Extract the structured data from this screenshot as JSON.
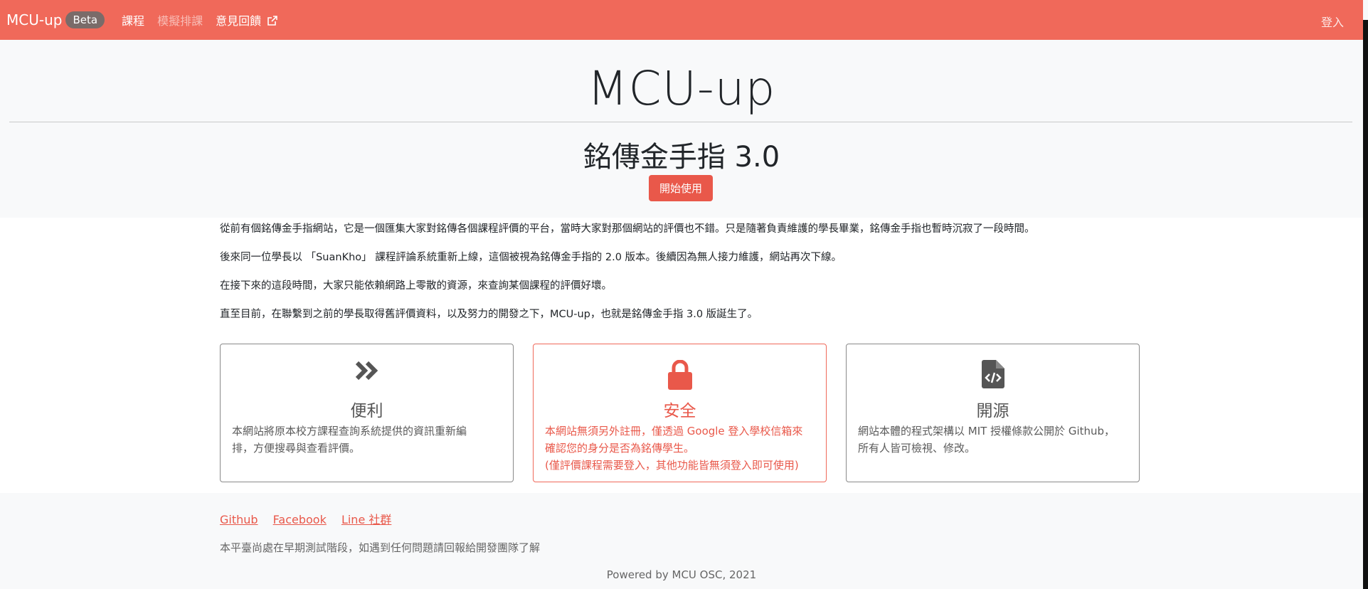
{
  "navbar": {
    "brand": "MCU-up",
    "badge": "Beta",
    "links": [
      "課程",
      "模擬排課",
      "意見回饋"
    ],
    "login": "登入",
    "colors": {
      "brand_bg": "#f0695a",
      "badge_bg": "#7a6b69"
    }
  },
  "hero": {
    "title": "MCU-up",
    "subtitle": "銘傳金手指 3.0",
    "start_button": "開始使用"
  },
  "intro": [
    "從前有個銘傳金手指網站，它是一個匯集大家對銘傳各個課程評價的平台，當時大家對那個網站的評價也不錯。只是隨著負責維護的學長畢業，銘傳金手指也暫時沉寂了一段時間。",
    "後來同一位學長以 「SuanKho」 課程評論系統重新上線，這個被視為銘傳金手指的 2.0 版本。後續因為無人接力維護，網站再次下線。",
    "在接下來的這段時間，大家只能依賴網路上零散的資源，來查詢某個課程的評價好壞。",
    "直至目前，在聯繫到之前的學長取得舊評價資料，以及努力的開發之下，MCU-up，也就是銘傳金手指 3.0 版誕生了。"
  ],
  "features": [
    {
      "icon": "double-chevron-right-icon",
      "title": "便利",
      "lines": [
        "本網站將原本校方課程查詢系統提供的資訊重新編",
        "排，方便搜尋與查看評價。"
      ]
    },
    {
      "icon": "lock-icon",
      "title": "安全",
      "lines": [
        "本網站無須另外註冊，僅透過 Google 登入學校信箱來",
        "確認您的身分是否為銘傳學生。",
        "(僅評價課程需要登入，其他功能皆無須登入即可使用)"
      ]
    },
    {
      "icon": "code-file-icon",
      "title": "開源",
      "lines": [
        "網站本體的程式架構以 MIT 授權條款公開於 Github，",
        "所有人皆可檢視、修改。"
      ]
    }
  ],
  "footer": {
    "links": [
      "Github",
      "Facebook",
      "Line 社群"
    ],
    "note": "本平臺尚處在早期測試階段，如遇到任何問題請回報給開發團隊了解",
    "powered": "Powered by MCU OSC, 2021"
  }
}
